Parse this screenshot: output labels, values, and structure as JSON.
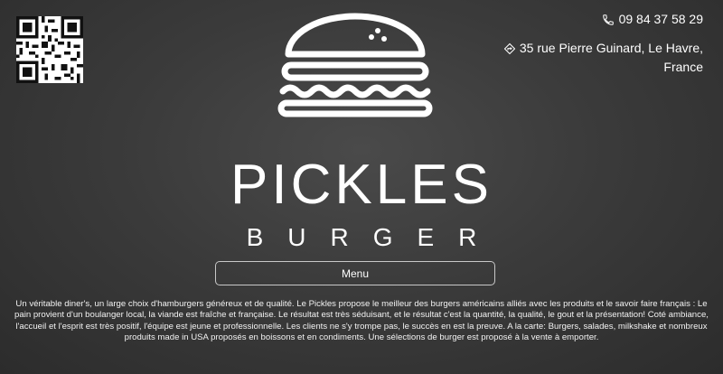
{
  "header": {
    "phone": {
      "icon": "phone-icon",
      "text": "09 84 37 58 29"
    },
    "address": {
      "icon": "directions-icon",
      "line1": "35 rue Pierre Guinard, Le Havre,",
      "line2": "France"
    },
    "qr_icon": "qr-code-icon"
  },
  "brand": {
    "logo_icon": "burger-logo-icon",
    "name": "PICKLES",
    "subtitle": "BURGER"
  },
  "nav": {
    "menu_label": "Menu"
  },
  "description": "Un véritable diner's, un large choix d'hamburgers généreux et de qualité. Le Pickles propose le meilleur des burgers américains alliés avec les produits et le savoir faire français : Le pain provient d'un boulanger local, la viande est fraîche et française. Le résultat est très séduisant, et le résultat c'est la quantité, la qualité, le gout et la présentation! Coté ambiance, l'accueil et l'esprit est très positif, l'équipe est jeune et professionnelle. Les clients ne s'y trompe pas, le succès en est la preuve. A la carte: Burgers, salades, milkshake et nombreux produits made in USA proposés en boissons et en condiments. Une sélections de burger est proposé à la vente à emporter.",
  "colors": {
    "background": "#3b3b3b",
    "text": "#ffffff",
    "button_border": "#c8c8c8"
  }
}
